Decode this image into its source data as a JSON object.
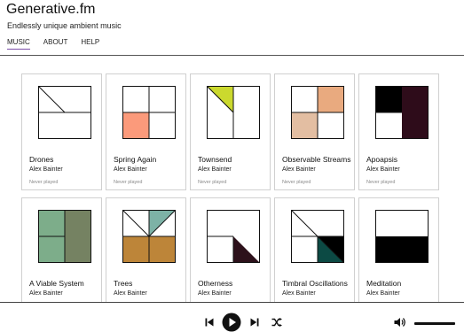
{
  "app": {
    "title": "Generative.fm",
    "subtitle": "Endlessly unique ambient music"
  },
  "nav": {
    "tabs": [
      {
        "label": "MUSIC",
        "active": true
      },
      {
        "label": "ABOUT",
        "active": false
      },
      {
        "label": "HELP",
        "active": false
      }
    ]
  },
  "pieces": [
    {
      "title": "Drones",
      "artist": "Alex Bainter",
      "status": "Never played",
      "art": "drones-art"
    },
    {
      "title": "Spring Again",
      "artist": "Alex Bainter",
      "status": "Never played",
      "art": "spring-again-art"
    },
    {
      "title": "Townsend",
      "artist": "Alex Bainter",
      "status": "Never played",
      "art": "townsend-art"
    },
    {
      "title": "Observable Streams",
      "artist": "Alex Bainter",
      "status": "Never played",
      "art": "observable-streams-art"
    },
    {
      "title": "Apoapsis",
      "artist": "Alex Bainter",
      "status": "Never played",
      "art": "apoapsis-art"
    },
    {
      "title": "A Viable System",
      "artist": "Alex Bainter",
      "status": "",
      "art": "a-viable-system-art"
    },
    {
      "title": "Trees",
      "artist": "Alex Bainter",
      "status": "",
      "art": "trees-art"
    },
    {
      "title": "Otherness",
      "artist": "Alex Bainter",
      "status": "",
      "art": "otherness-art"
    },
    {
      "title": "Timbral Oscillations",
      "artist": "Alex Bainter",
      "status": "",
      "art": "timbral-oscillations-art"
    },
    {
      "title": "Meditation",
      "artist": "Alex Bainter",
      "status": "",
      "art": "meditation-art"
    }
  ],
  "colors": {
    "nav_active_underline": "#7b4ea8",
    "spring_peach": "#fb9a7b",
    "townsend_lime": "#cbd92e",
    "observable_orange": "#e9aa7f",
    "observable_tan": "#e3bea2",
    "apoapsis_maroon": "#2e0c1a",
    "viable_green_light": "#7dad8a",
    "viable_green_dark": "#758262",
    "trees_teal": "#7db2a6",
    "trees_ochre": "#bd8539",
    "otherness_plum": "#2d111b",
    "timbral_teal": "#0c4a44"
  },
  "player": {
    "volume": 1.0,
    "icons": [
      "previous-icon",
      "play-icon",
      "next-icon",
      "shuffle-icon",
      "volume-icon"
    ]
  }
}
